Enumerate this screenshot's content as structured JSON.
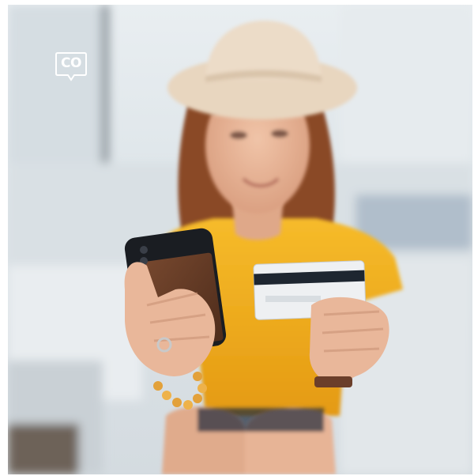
{
  "image": {
    "subject": "woman-holding-phone-and-credit-card",
    "logo": {
      "text": "CO",
      "icon": "speech-bubble-icon"
    },
    "colors": {
      "shirt": "#f2b01e",
      "hat": "#e8d6bf",
      "hair": "#8a4a26",
      "skin": "#e9b79a",
      "phone_case": "#6b3f28",
      "card": "#eef0f2",
      "card_stripe": "#1e2630",
      "background": "#dfe6ea"
    }
  }
}
